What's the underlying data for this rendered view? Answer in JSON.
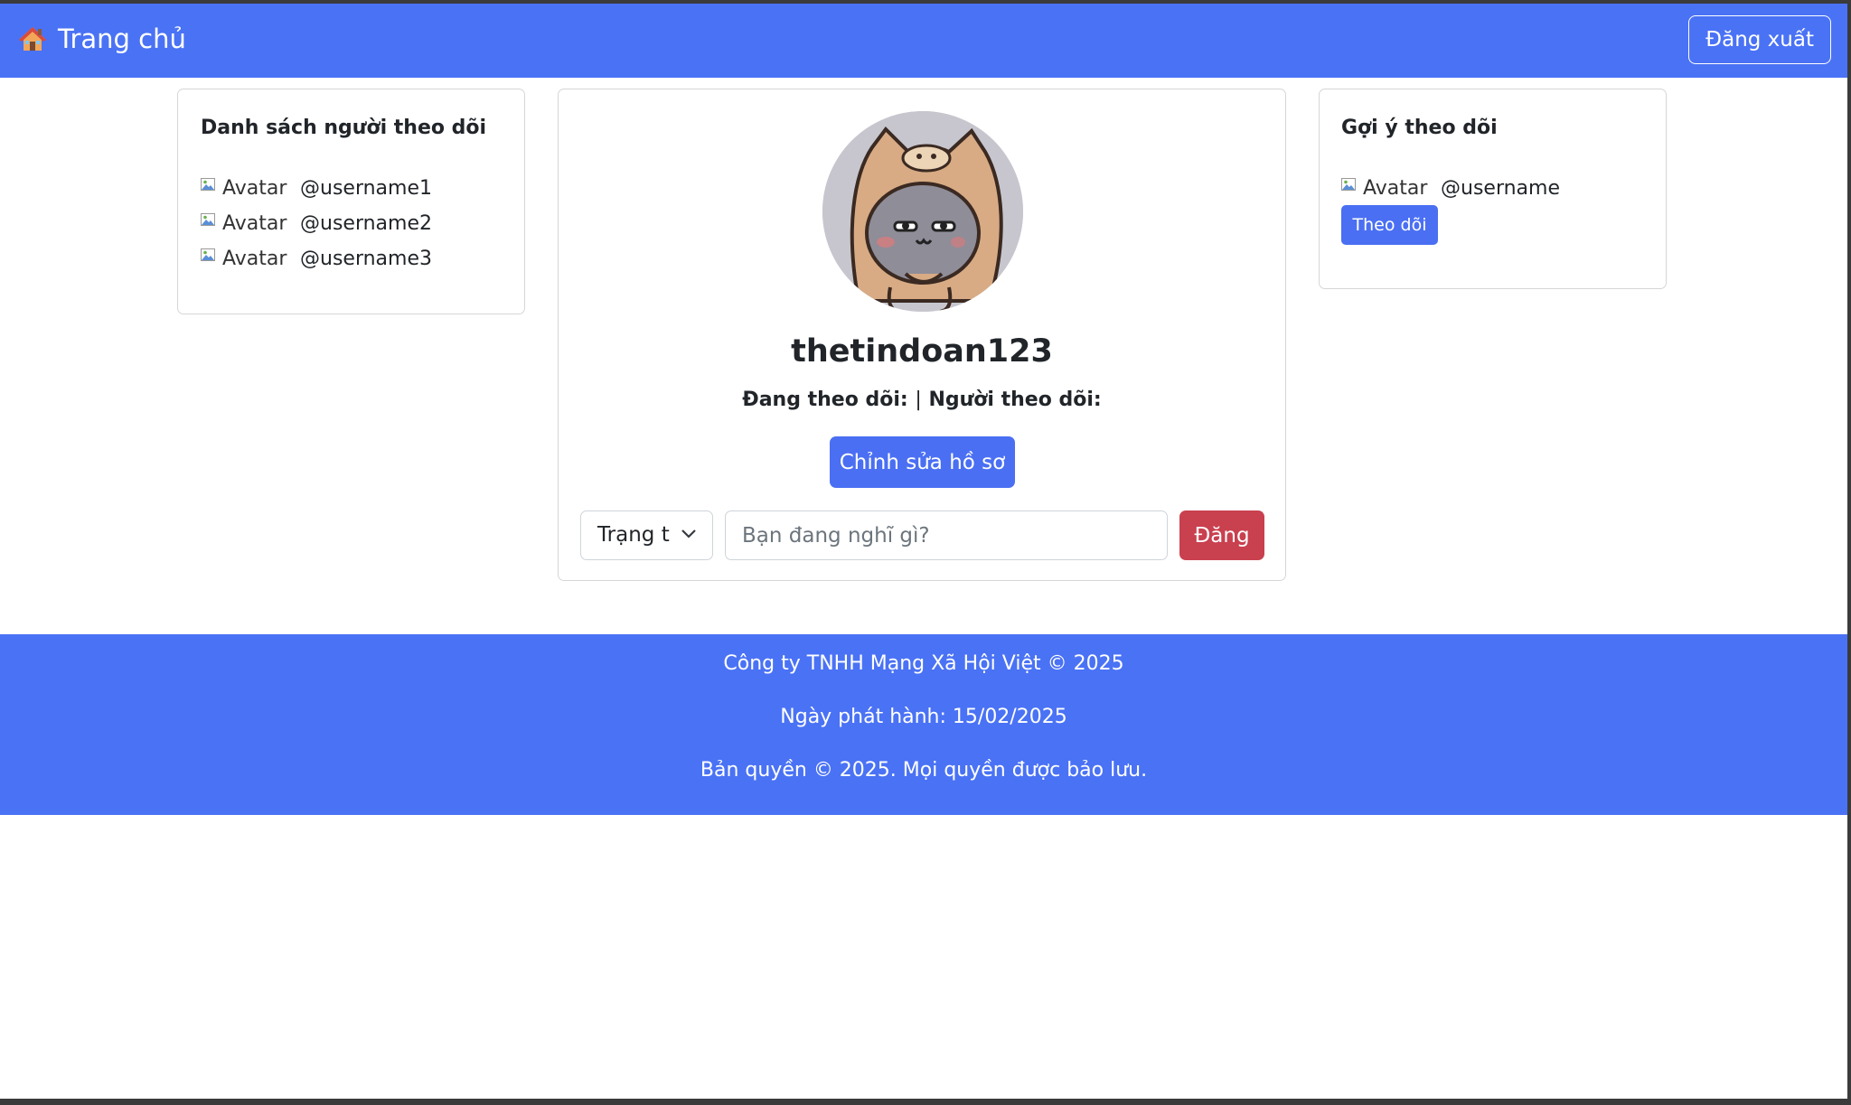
{
  "navbar": {
    "brand_label": "Trang chủ",
    "brand_icon": "house-icon",
    "logout_label": "Đăng xuất",
    "bg_color": "#4a72f5"
  },
  "followers": {
    "title": "Danh sách người theo dõi",
    "items": [
      {
        "avatar_alt": "Avatar",
        "handle": "@username1"
      },
      {
        "avatar_alt": "Avatar",
        "handle": "@username2"
      },
      {
        "avatar_alt": "Avatar",
        "handle": "@username3"
      }
    ]
  },
  "profile": {
    "username": "thetindoan123",
    "following_label": "Đang theo dõi:",
    "separator": "|",
    "followers_label": "Người theo dõi:",
    "edit_label": "Chỉnh sửa hồ sơ",
    "status_select_value": "Trạng t",
    "post_placeholder": "Bạn đang nghĩ gì?",
    "post_label": "Đăng"
  },
  "suggestions": {
    "title": "Gợi ý theo dõi",
    "items": [
      {
        "avatar_alt": "Avatar",
        "handle": "@username",
        "follow_label": "Theo dõi"
      }
    ]
  },
  "footer": {
    "company": "Công ty TNHH Mạng Xã Hội Việt © 2025",
    "release_date": "Ngày phát hành: 15/02/2025",
    "copyright": "Bản quyền © 2025. Mọi quyền được bảo lưu."
  }
}
